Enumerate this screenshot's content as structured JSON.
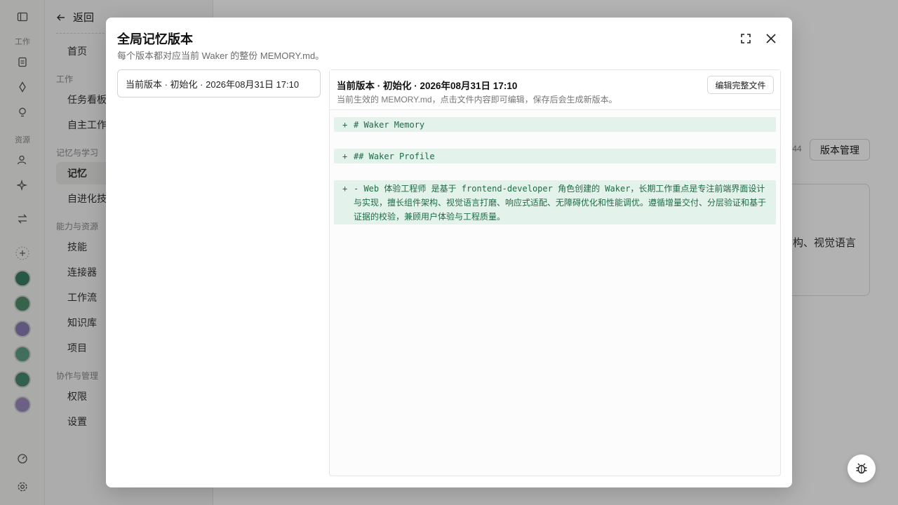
{
  "rail": {
    "section_work": "工作",
    "section_resources": "资源"
  },
  "sidebar": {
    "back_label": "返回",
    "items_top": [
      {
        "label": "首页"
      }
    ],
    "sections": {
      "work": "工作",
      "memory": "记忆与学习",
      "capability": "能力与资源",
      "collab": "协作与管理"
    },
    "items": {
      "task_board": "任务看板",
      "autonomous": "自主工作",
      "memory": "记忆",
      "self_evolve": "自进化技能",
      "skills": "技能",
      "connectors": "连接器",
      "workflows": "工作流",
      "knowledge": "知识库",
      "projects": "项目",
      "permissions": "权限",
      "settings": "设置"
    }
  },
  "background": {
    "time_fragment": ":44",
    "version_button": "版本管理",
    "card_text_fragment": "构、视觉语言"
  },
  "modal": {
    "title": "全局记忆版本",
    "subtitle": "每个版本都对应当前 Waker 的整份 MEMORY.md。",
    "versions": [
      {
        "label": "当前版本 · 初始化 · 2026年08月31日 17:10"
      }
    ],
    "panel": {
      "title": "当前版本 · 初始化 · 2026年08月31日 17:10",
      "description": "当前生效的 MEMORY.md，点击文件内容即可编辑，保存后会生成新版本。",
      "edit_button": "编辑完整文件",
      "diff_lines": [
        {
          "sign": "+",
          "text": "# Waker Memory"
        },
        {
          "sign": "+",
          "text": "## Waker Profile"
        },
        {
          "sign": "+",
          "text": "- Web 体验工程师 是基于 frontend-developer 角色创建的 Waker，长期工作重点是专注前端界面设计与实现，擅长组件架构、视觉语言打磨、响应式适配、无障碍优化和性能调优。遵循增量交付、分层验证和基于证据的校验，兼顾用户体验与工程质量。"
        }
      ]
    }
  },
  "colors": {
    "diff_add_bg": "#e3f2ea",
    "diff_add_text": "#1f6b45"
  }
}
